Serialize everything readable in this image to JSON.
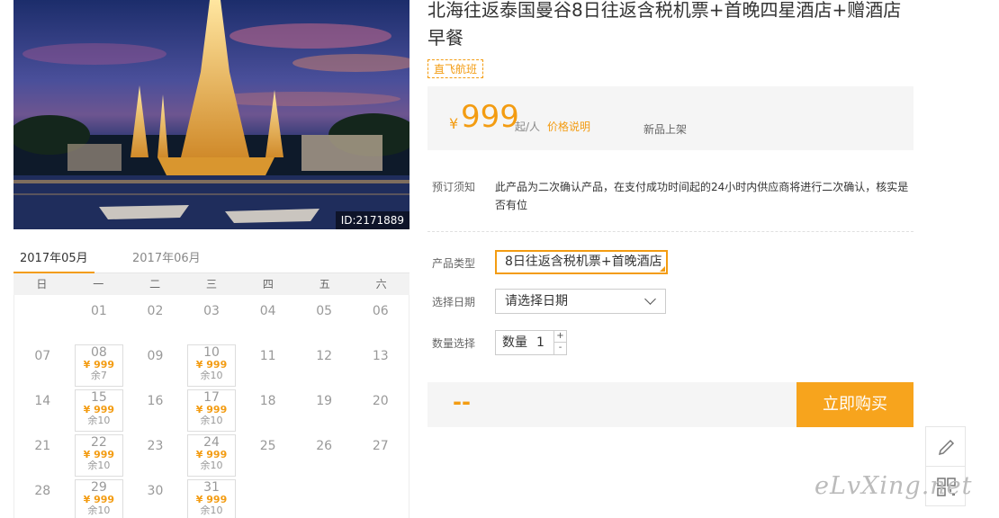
{
  "product": {
    "title": "北海往返泰国曼谷8日往返含税机票+首晚四星酒店+赠酒店早餐",
    "badge": "直飞航班",
    "image_id": "ID:2171889"
  },
  "price": {
    "currency": "¥",
    "amount": "999",
    "unit": "起/人",
    "explain_link": "价格说明",
    "new_tag": "新品上架"
  },
  "notice": {
    "label": "预订须知",
    "text": "此产品为二次确认产品，在支付成功时间起的24小时内供应商将进行二次确认，核实是否有位"
  },
  "form": {
    "product_type_label": "产品类型",
    "product_type_value": "8日往返含税机票+首晚酒店",
    "date_label": "选择日期",
    "date_placeholder": "请选择日期",
    "qty_label": "数量选择",
    "qty_text": "数量",
    "qty_value": "1",
    "qty_plus": "+",
    "qty_minus": "-"
  },
  "buy": {
    "total": "--",
    "button": "立即购买"
  },
  "calendar": {
    "tabs": [
      "2017年05月",
      "2017年06月"
    ],
    "weekdays": [
      "日",
      "一",
      "二",
      "三",
      "四",
      "五",
      "六"
    ],
    "weeks": [
      [
        {
          "d": ""
        },
        {
          "d": "01"
        },
        {
          "d": "02"
        },
        {
          "d": "03"
        },
        {
          "d": "04"
        },
        {
          "d": "05"
        },
        {
          "d": "06"
        }
      ],
      [
        {
          "d": "07"
        },
        {
          "d": "08",
          "p": "¥ 999",
          "r": "余7"
        },
        {
          "d": "09"
        },
        {
          "d": "10",
          "p": "¥ 999",
          "r": "余10"
        },
        {
          "d": "11"
        },
        {
          "d": "12"
        },
        {
          "d": "13"
        }
      ],
      [
        {
          "d": "14"
        },
        {
          "d": "15",
          "p": "¥ 999",
          "r": "余10"
        },
        {
          "d": "16"
        },
        {
          "d": "17",
          "p": "¥ 999",
          "r": "余10"
        },
        {
          "d": "18"
        },
        {
          "d": "19"
        },
        {
          "d": "20"
        }
      ],
      [
        {
          "d": "21"
        },
        {
          "d": "22",
          "p": "¥ 999",
          "r": "余10"
        },
        {
          "d": "23"
        },
        {
          "d": "24",
          "p": "¥ 999",
          "r": "余10"
        },
        {
          "d": "25"
        },
        {
          "d": "26"
        },
        {
          "d": "27"
        }
      ],
      [
        {
          "d": "28"
        },
        {
          "d": "29",
          "p": "¥ 999",
          "r": "余10"
        },
        {
          "d": "30"
        },
        {
          "d": "31",
          "p": "¥ 999",
          "r": "余10"
        },
        {
          "d": ""
        },
        {
          "d": ""
        },
        {
          "d": ""
        }
      ]
    ]
  },
  "tools": {
    "edit_icon": "pencil-icon",
    "qr_icon": "qr-code-icon"
  },
  "watermark": "eLvXing.net",
  "colors": {
    "accent": "#f39c12",
    "buy_button": "#f7a41d"
  }
}
